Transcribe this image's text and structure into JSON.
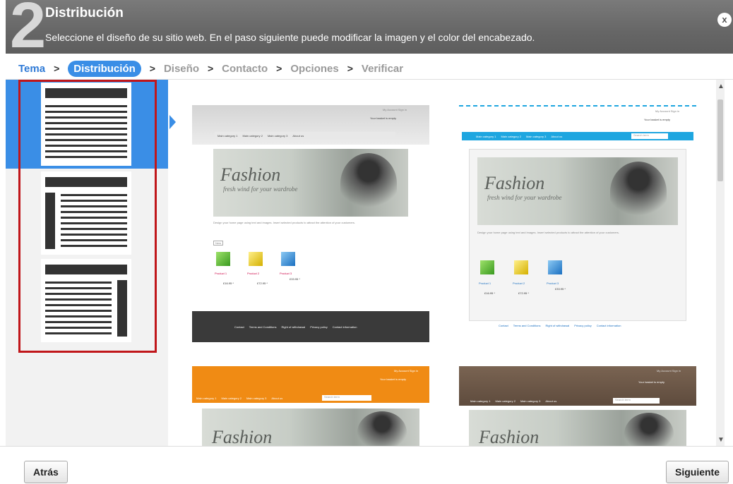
{
  "header": {
    "step_number": "2",
    "title": "Distribución",
    "subtitle": "Seleccione el diseño de su sitio web. En el paso siguiente puede modificar la imagen y el color del encabezado.",
    "close_label": "x"
  },
  "breadcrumb": {
    "steps": [
      "Tema",
      "Distribución",
      "Diseño",
      "Contacto",
      "Opciones",
      "Verificar"
    ],
    "separator": ">",
    "active_index": 1
  },
  "colors": {
    "accent": "#3a8ee6",
    "header_bg": "#6a6a6a",
    "highlight": "#c0161a",
    "orange_theme": "#f08b14",
    "brown_theme": "#6a5546",
    "blue_theme": "#1ea6e0"
  },
  "previews": {
    "basket": "Your basket is empty",
    "my_account": "My Account   Sign in",
    "nav": [
      "Main category 1",
      "Main category 2",
      "Main category 3",
      "About us"
    ],
    "search_placeholder": "Search term",
    "hero_title": "Fashion",
    "hero_tagline": "fresh wind for your wardrobe",
    "body_text": "Design your home page using text and images. Insert selected products to attract the attention of your customers.",
    "new_badge": "New",
    "products": [
      "Product 1",
      "Product 2",
      "Product 3"
    ],
    "prices": [
      "£16.95 *",
      "£72.95 *",
      "£33.95 *"
    ],
    "footer_links": [
      "Contact",
      "Terms and Conditions",
      "Right of withdrawal",
      "Privacy policy",
      "Contact information"
    ]
  },
  "footer": {
    "back_label": "Atrás",
    "next_label": "Siguiente"
  }
}
